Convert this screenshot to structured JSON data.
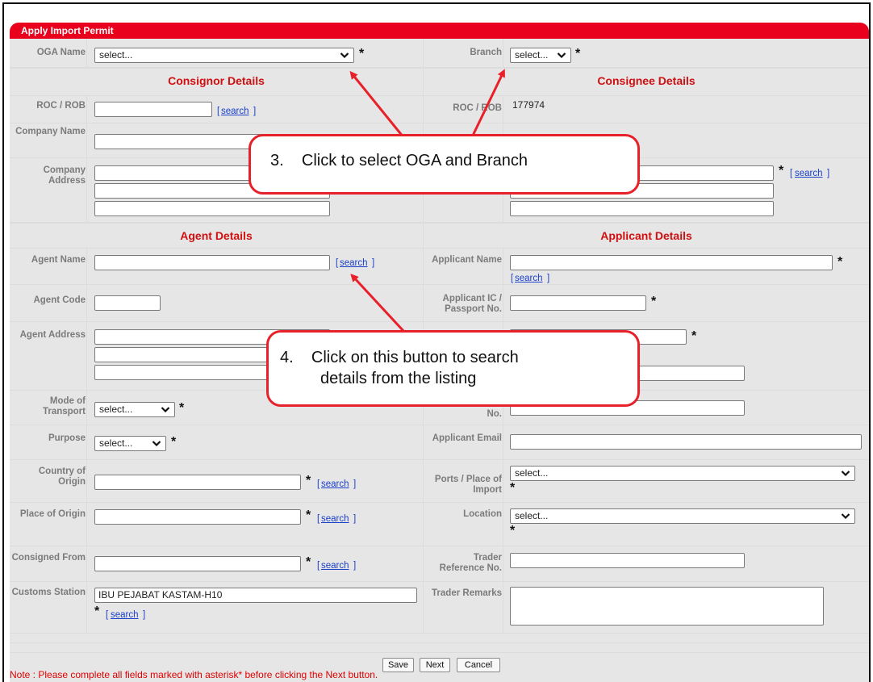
{
  "title": "Apply Import Permit",
  "top": {
    "oga_label": "OGA Name",
    "oga_value": "select...",
    "branch_label": "Branch",
    "branch_value": "select..."
  },
  "consignor": {
    "header": "Consignor Details",
    "roc_label": "ROC / ROB",
    "search": "search",
    "name_label": "Company Name",
    "address_label": "Company Address"
  },
  "consignee": {
    "header": "Consignee Details",
    "roc_label": "ROC / ROB",
    "roc_value": "177974",
    "search": "search"
  },
  "agent": {
    "header": "Agent Details",
    "name_label": "Agent Name",
    "search": "search",
    "code_label": "Agent Code",
    "address_label": "Agent Address",
    "mode_label": "Mode of Transport",
    "mode_value": "select...",
    "purpose_label": "Purpose",
    "purpose_value": "select...",
    "country_label": "Country of Origin",
    "place_label": "Place of Origin",
    "consigned_label": "Consigned From",
    "customs_label": "Customs Station",
    "customs_value": "IBU PEJABAT KASTAM-H10"
  },
  "applicant": {
    "header": "Applicant Details",
    "name_label": "Applicant Name",
    "search": "search",
    "ic_label": "Applicant IC / Passport No.",
    "no_label": "No.",
    "email_label": "Applicant Email",
    "ports_label": "Ports / Place of Import",
    "ports_value": "select...",
    "location_label": "Location",
    "location_value": "select...",
    "trader_ref_label": "Trader Reference No.",
    "trader_remarks_label": "Trader Remarks"
  },
  "buttons": {
    "save": "Save",
    "next": "Next",
    "cancel": "Cancel"
  },
  "note": "Note : Please complete all fields marked with asterisk* before clicking the Next button.",
  "callouts": {
    "step3": "3.    Click to select OGA and Branch",
    "step4_line1": "4.    Click on this button to search",
    "step4_line2": "details from the listing"
  },
  "colors": {
    "title_bar": "#e8001c",
    "section_header": "#d01010",
    "label": "#7b7b7b",
    "link": "#1a3fc9",
    "callout_border": "#e8202a"
  }
}
